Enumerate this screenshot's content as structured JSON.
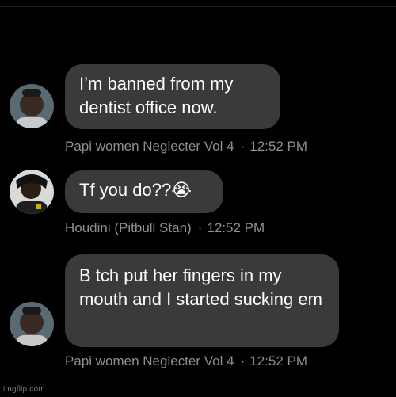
{
  "messages": [
    {
      "text": "I’m banned from my dentist office now.",
      "sender": "Papi women Neglecter Vol 4",
      "time": "12:52 PM"
    },
    {
      "text": "Tf you do??😭",
      "sender": "Houdini (Pitbull Stan)",
      "time": "12:52 PM"
    },
    {
      "text": "B tch put her fingers in my mouth and I started sucking em",
      "sender": "Papi women Neglecter Vol 4",
      "time": "12:52 PM"
    }
  ],
  "separator": "·",
  "watermark": "imgflip.com",
  "colors": {
    "background": "#000000",
    "bubble": "#3a3a3c",
    "meta_text": "#8e8e93"
  }
}
